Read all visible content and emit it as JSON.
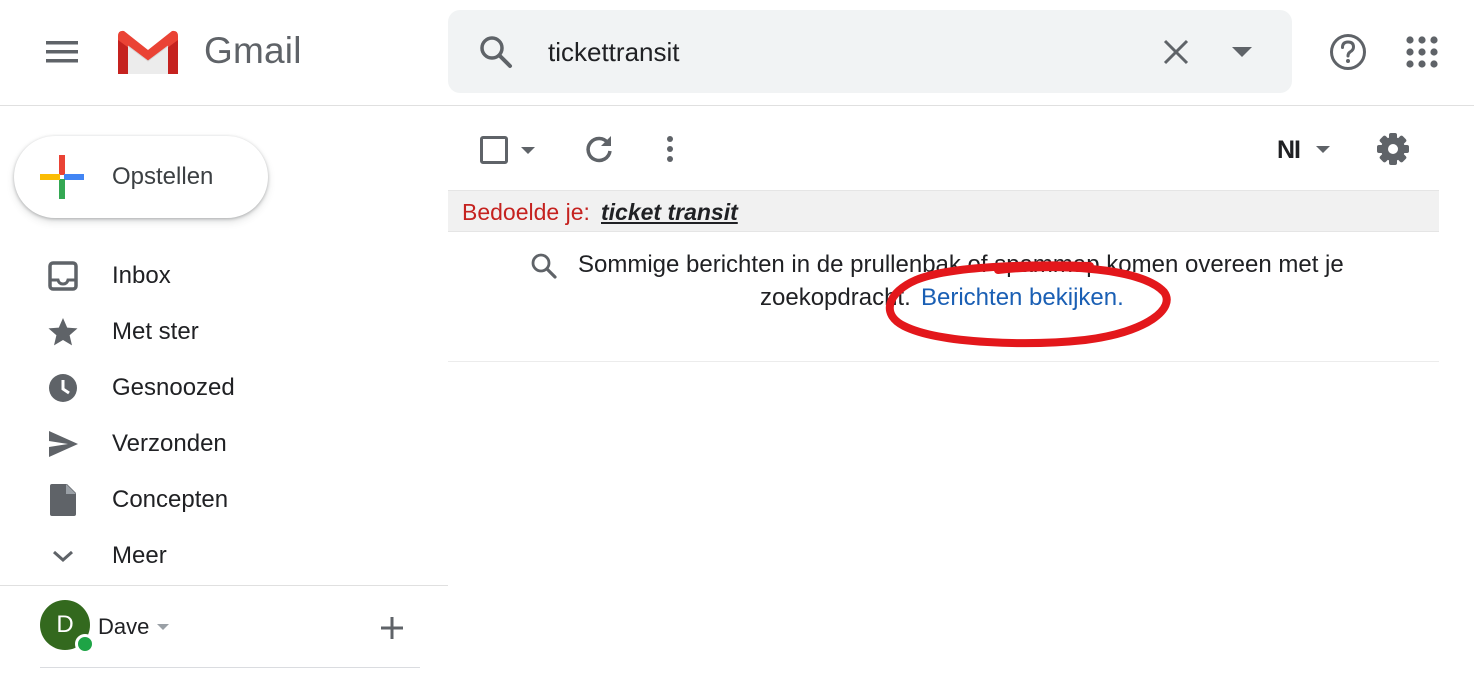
{
  "header": {
    "app_name": "Gmail",
    "search_value": "tickettransit"
  },
  "sidebar": {
    "compose_label": "Opstellen",
    "items": [
      {
        "label": "Inbox",
        "icon": "inbox-icon"
      },
      {
        "label": "Met ster",
        "icon": "star-icon"
      },
      {
        "label": "Gesnoozed",
        "icon": "clock-icon"
      },
      {
        "label": "Verzonden",
        "icon": "send-icon"
      },
      {
        "label": "Concepten",
        "icon": "draft-icon"
      },
      {
        "label": "Meer",
        "icon": "chevron-down-icon"
      }
    ],
    "user": {
      "initial": "D",
      "name": "Dave"
    }
  },
  "toolbar": {
    "input_tools_label": "NI"
  },
  "content": {
    "suggestion_prefix": "Bedoelde je:",
    "suggestion_link": "ticket transit",
    "info_line1": "Sommige berichten in de prullenbak of spammap komen overeen met je",
    "info_line2": "zoekopdracht.",
    "info_link": "Berichten bekijken."
  },
  "colors": {
    "annotation": "#e3171b",
    "link": "#1a5fb4",
    "suggestion_red": "#c5221f"
  }
}
